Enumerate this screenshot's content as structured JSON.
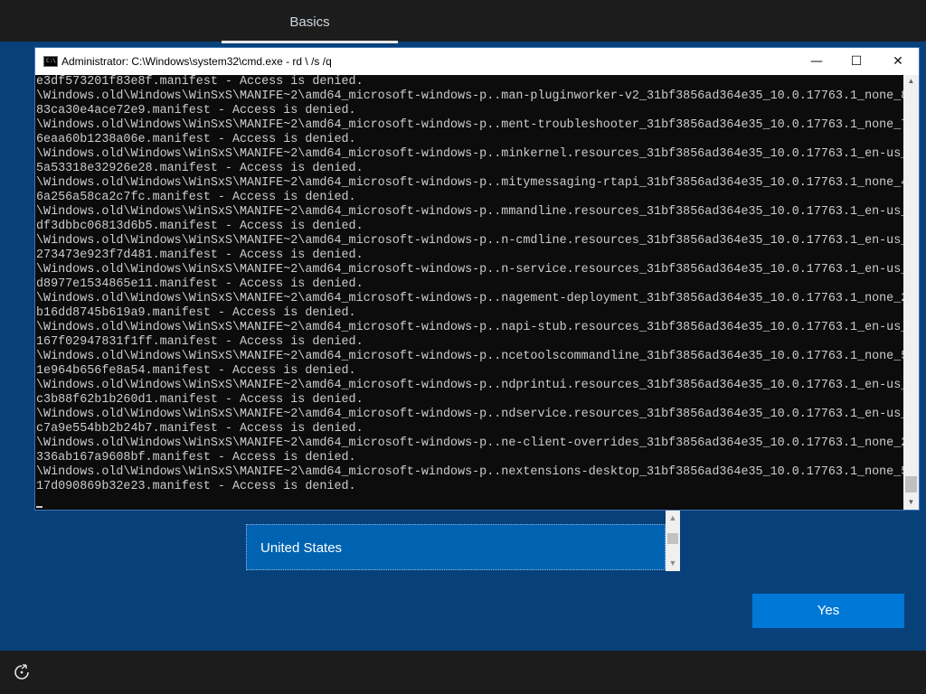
{
  "oobe": {
    "tab_label": "Basics",
    "region_selected": "United States",
    "yes_label": "Yes"
  },
  "cmd": {
    "title": "Administrator: C:\\Windows\\system32\\cmd.exe - rd \\ /s /q",
    "icon_text": "C:\\",
    "minimize": "—",
    "maximize": "☐",
    "close": "✕",
    "lines": [
      "e3df573201f83e8f.manifest - Access is denied.",
      "\\Windows.old\\Windows\\WinSxS\\MANIFE~2\\amd64_microsoft-windows-p..man-pluginworker-v2_31bf3856ad364e35_10.0.17763.1_none_8",
      "83ca30e4ace72e9.manifest - Access is denied.",
      "\\Windows.old\\Windows\\WinSxS\\MANIFE~2\\amd64_microsoft-windows-p..ment-troubleshooter_31bf3856ad364e35_10.0.17763.1_none_7",
      "6eaa60b1238a06e.manifest - Access is denied.",
      "\\Windows.old\\Windows\\WinSxS\\MANIFE~2\\amd64_microsoft-windows-p..minkernel.resources_31bf3856ad364e35_10.0.17763.1_en-us_",
      "5a53318e32926e28.manifest - Access is denied.",
      "\\Windows.old\\Windows\\WinSxS\\MANIFE~2\\amd64_microsoft-windows-p..mitymessaging-rtapi_31bf3856ad364e35_10.0.17763.1_none_4",
      "6a256a58ca2c7fc.manifest - Access is denied.",
      "\\Windows.old\\Windows\\WinSxS\\MANIFE~2\\amd64_microsoft-windows-p..mmandline.resources_31bf3856ad364e35_10.0.17763.1_en-us_",
      "df3dbbc06813d6b5.manifest - Access is denied.",
      "\\Windows.old\\Windows\\WinSxS\\MANIFE~2\\amd64_microsoft-windows-p..n-cmdline.resources_31bf3856ad364e35_10.0.17763.1_en-us_",
      "273473e923f7d481.manifest - Access is denied.",
      "\\Windows.old\\Windows\\WinSxS\\MANIFE~2\\amd64_microsoft-windows-p..n-service.resources_31bf3856ad364e35_10.0.17763.1_en-us_",
      "d8977e1534865e11.manifest - Access is denied.",
      "\\Windows.old\\Windows\\WinSxS\\MANIFE~2\\amd64_microsoft-windows-p..nagement-deployment_31bf3856ad364e35_10.0.17763.1_none_2",
      "b16dd8745b619a9.manifest - Access is denied.",
      "\\Windows.old\\Windows\\WinSxS\\MANIFE~2\\amd64_microsoft-windows-p..napi-stub.resources_31bf3856ad364e35_10.0.17763.1_en-us_",
      "167f02947831f1ff.manifest - Access is denied.",
      "\\Windows.old\\Windows\\WinSxS\\MANIFE~2\\amd64_microsoft-windows-p..ncetoolscommandline_31bf3856ad364e35_10.0.17763.1_none_5",
      "1e964b656fe8a54.manifest - Access is denied.",
      "\\Windows.old\\Windows\\WinSxS\\MANIFE~2\\amd64_microsoft-windows-p..ndprintui.resources_31bf3856ad364e35_10.0.17763.1_en-us_",
      "c3b88f62b1b260d1.manifest - Access is denied.",
      "\\Windows.old\\Windows\\WinSxS\\MANIFE~2\\amd64_microsoft-windows-p..ndservice.resources_31bf3856ad364e35_10.0.17763.1_en-us_",
      "c7a9e554bb2b24b7.manifest - Access is denied.",
      "\\Windows.old\\Windows\\WinSxS\\MANIFE~2\\amd64_microsoft-windows-p..ne-client-overrides_31bf3856ad364e35_10.0.17763.1_none_2",
      "336ab167a9608bf.manifest - Access is denied.",
      "\\Windows.old\\Windows\\WinSxS\\MANIFE~2\\amd64_microsoft-windows-p..nextensions-desktop_31bf3856ad364e35_10.0.17763.1_none_5",
      "17d090869b32e23.manifest - Access is denied."
    ]
  },
  "colors": {
    "oobe_background": "#08417a",
    "accent": "#0078d7",
    "console_background": "#0c0c0c",
    "console_text": "#cccccc"
  },
  "icons": {
    "accessibility": "ease-of-access-icon",
    "cmd": "command-prompt-icon"
  }
}
